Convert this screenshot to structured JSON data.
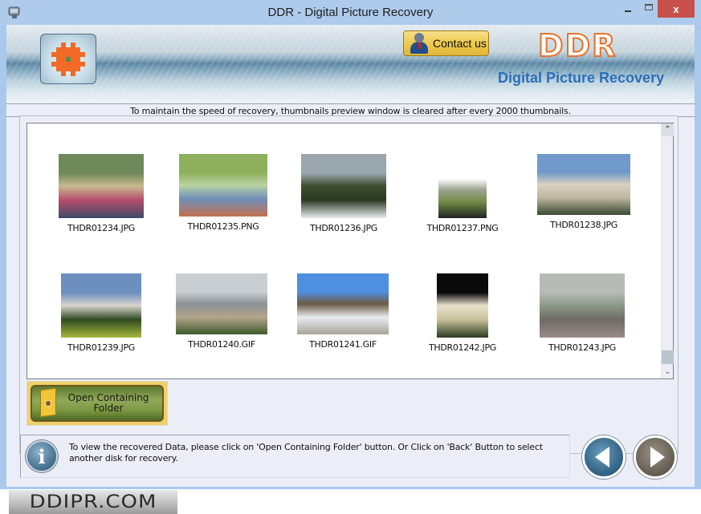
{
  "window": {
    "title": "DDR - Digital Picture Recovery",
    "controls": {
      "minimize": "minimize",
      "maximize": "maximize",
      "close": "x"
    }
  },
  "header": {
    "contact_label": "Contact us",
    "brand": "DDR",
    "brand_subtitle": "Digital Picture Recovery"
  },
  "notice": "To maintain the speed of recovery, thumbnails preview window is cleared after every 2000 thumbnails.",
  "gallery": {
    "thumbnails": [
      {
        "name": "THDR01234.JPG",
        "palette": [
          "#6e8a5a",
          "#c9b98e",
          "#b54d6d",
          "#3d4a66"
        ]
      },
      {
        "name": "THDR01235.PNG",
        "palette": [
          "#8fb05c",
          "#b9d3a2",
          "#6f8fb9",
          "#c2704f"
        ]
      },
      {
        "name": "THDR01236.JPG",
        "palette": [
          "#9aa6ae",
          "#3d4d2e",
          "#2a3a22",
          "#e9ecef"
        ]
      },
      {
        "name": "THDR01237.PNG",
        "palette": [
          "#ffffff",
          "#9aa38e",
          "#6f8a44",
          "#222222"
        ]
      },
      {
        "name": "THDR01238.JPG",
        "palette": [
          "#6f9ac9",
          "#d9d1c0",
          "#bfb5a0",
          "#3a4a30"
        ]
      },
      {
        "name": "THDR01239.JPG",
        "palette": [
          "#6c8fbf",
          "#d9d6cc",
          "#2f4a22",
          "#a6b83c"
        ]
      },
      {
        "name": "THDR01240.GIF",
        "palette": [
          "#c9ced2",
          "#8c9196",
          "#b2a58a",
          "#3f5a2a"
        ]
      },
      {
        "name": "THDR01241.GIF",
        "palette": [
          "#4f8fe0",
          "#6d5a44",
          "#e8ecf0",
          "#a9a39a"
        ]
      },
      {
        "name": "THDR01242.JPG",
        "palette": [
          "#0a0a0a",
          "#e8e2cc",
          "#c8c29a",
          "#2a3a20"
        ]
      },
      {
        "name": "THDR01243.JPG",
        "palette": [
          "#b8bab6",
          "#8a9a86",
          "#6e6a66",
          "#9c8c88"
        ]
      }
    ],
    "scroll_up": "^",
    "scroll_down": "v"
  },
  "actions": {
    "open_folder_label": "Open Containing Folder"
  },
  "info": {
    "icon": "i",
    "text": "To view the recovered Data, please click on 'Open Containing Folder' button. Or Click on 'Back' Button to select another disk for recovery."
  },
  "footer": {
    "site": "DDIPR.COM"
  },
  "colors": {
    "titlebar": "#aecbec",
    "close": "#c7504b",
    "brand_orange": "#e8722a",
    "brand_blue": "#2b6fb8",
    "client_bg": "#ebeef6"
  }
}
